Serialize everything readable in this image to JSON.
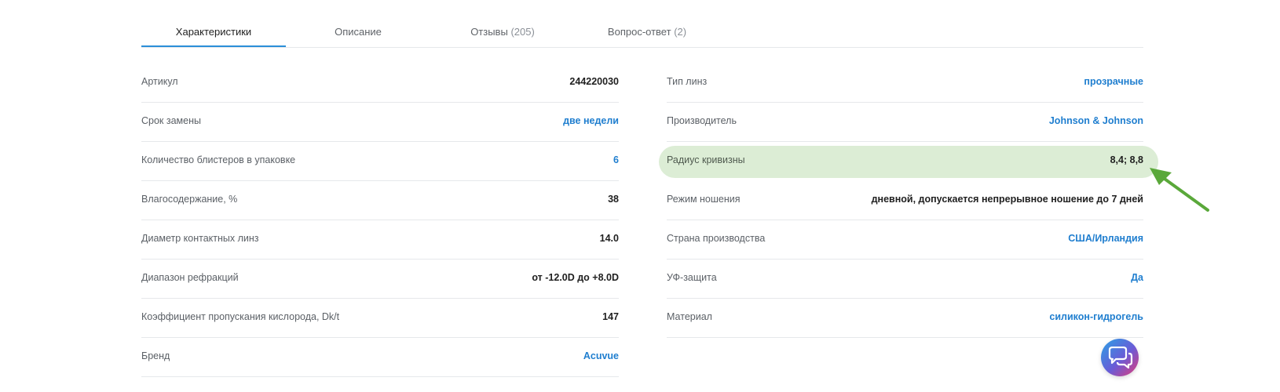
{
  "tabs": [
    {
      "label": "Характеристики",
      "count": "",
      "active": true
    },
    {
      "label": "Описание",
      "count": ""
    },
    {
      "label": "Отзывы",
      "count": "(205)"
    },
    {
      "label": "Вопрос-ответ",
      "count": "(2)"
    }
  ],
  "left_specs": [
    {
      "label": "Артикул",
      "value": "244220030"
    },
    {
      "label": "Срок замены",
      "value": "две недели",
      "link": true
    },
    {
      "label": "Количество блистеров в упаковке",
      "value": "6",
      "link": true
    },
    {
      "label": "Влагосодержание, %",
      "value": "38"
    },
    {
      "label": "Диаметр контактных линз",
      "value": "14.0"
    },
    {
      "label": "Диапазон рефракций",
      "value": "от -12.0D до +8.0D"
    },
    {
      "label": "Коэффициент пропускания кислорода, Dk/t",
      "value": "147"
    },
    {
      "label": "Бренд",
      "value": "Acuvue",
      "link": true
    }
  ],
  "right_specs": [
    {
      "label": "Тип линз",
      "value": "прозрачные",
      "link": true
    },
    {
      "label": "Производитель",
      "value": "Johnson & Johnson",
      "link": true
    },
    {
      "label": "Радиус кривизны",
      "value": "8,4; 8,8",
      "highlighted": true
    },
    {
      "label": "Режим ношения",
      "value": "дневной, допускается непрерывное ношение до 7 дней"
    },
    {
      "label": "Страна производства",
      "value": "США/Ирландия",
      "link": true
    },
    {
      "label": "УФ-защита",
      "value": "Да",
      "link": true
    },
    {
      "label": "Материал",
      "value": "силикон-гидрогель",
      "link": true
    }
  ],
  "colors": {
    "accent": "#2b8fd8",
    "link": "#1f7ecf",
    "highlight": "#dcedd5",
    "arrow": "#5aa83a"
  },
  "icons": {
    "chat": "chat-bubbles-icon",
    "annotation": "arrow-pointer-icon"
  }
}
